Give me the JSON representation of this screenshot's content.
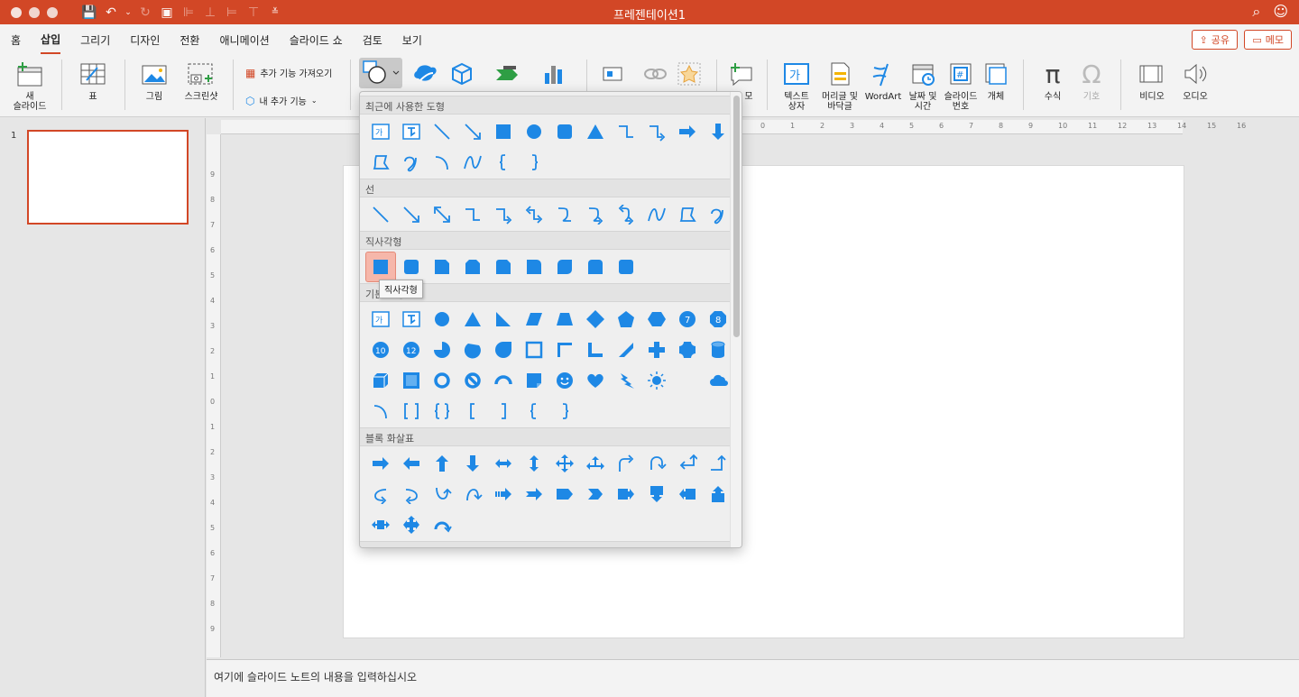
{
  "window": {
    "title": "프레젠테이션1"
  },
  "menu_tabs": [
    {
      "label": "홈",
      "active": false
    },
    {
      "label": "삽입",
      "active": true
    },
    {
      "label": "그리기",
      "active": false
    },
    {
      "label": "디자인",
      "active": false
    },
    {
      "label": "전환",
      "active": false
    },
    {
      "label": "애니메이션",
      "active": false
    },
    {
      "label": "슬라이드 쇼",
      "active": false
    },
    {
      "label": "검토",
      "active": false
    },
    {
      "label": "보기",
      "active": false
    }
  ],
  "header_buttons": {
    "share": "공유",
    "memo": "메모"
  },
  "ribbon": {
    "new_slide": "새\n슬라이드",
    "table": "표",
    "picture": "그림",
    "screenshot": "스크린샷",
    "get_addins": "추가 기능 가져오기",
    "my_addins": "내 추가 기능",
    "comment_partial": "모",
    "text_box": "텍스트\n상자",
    "header_footer": "머리글 및\n바닥글",
    "wordart": "WordArt",
    "date_time": "날짜 및\n시간",
    "slide_number": "슬라이드\n번호",
    "object": "개체",
    "equation": "수식",
    "symbol": "기호",
    "video": "비디오",
    "audio": "오디오"
  },
  "gallery": {
    "sections": {
      "recent": "최근에 사용한 도형",
      "lines": "선",
      "rectangles": "직사각형",
      "basic": "기본 도형",
      "block_arrows": "블록 화살표"
    },
    "tooltip": "직사각형"
  },
  "slides": [
    {
      "number": "1"
    }
  ],
  "notes": {
    "placeholder": "여기에 슬라이드 노트의 내용을 입력하십시오"
  },
  "ruler": {
    "top": [
      "0",
      "1",
      "2",
      "3",
      "4",
      "5",
      "6",
      "7",
      "8",
      "9",
      "10",
      "11",
      "12",
      "13",
      "14",
      "15",
      "16"
    ],
    "left": [
      "9",
      "8",
      "7",
      "6",
      "5",
      "4",
      "3",
      "2",
      "1",
      "0",
      "1",
      "2",
      "3",
      "4",
      "5",
      "6",
      "7",
      "8",
      "9"
    ]
  },
  "colors": {
    "brand": "#d24726",
    "shape_blue": "#1e88e5",
    "selected_cell": "#f6b7aa"
  }
}
